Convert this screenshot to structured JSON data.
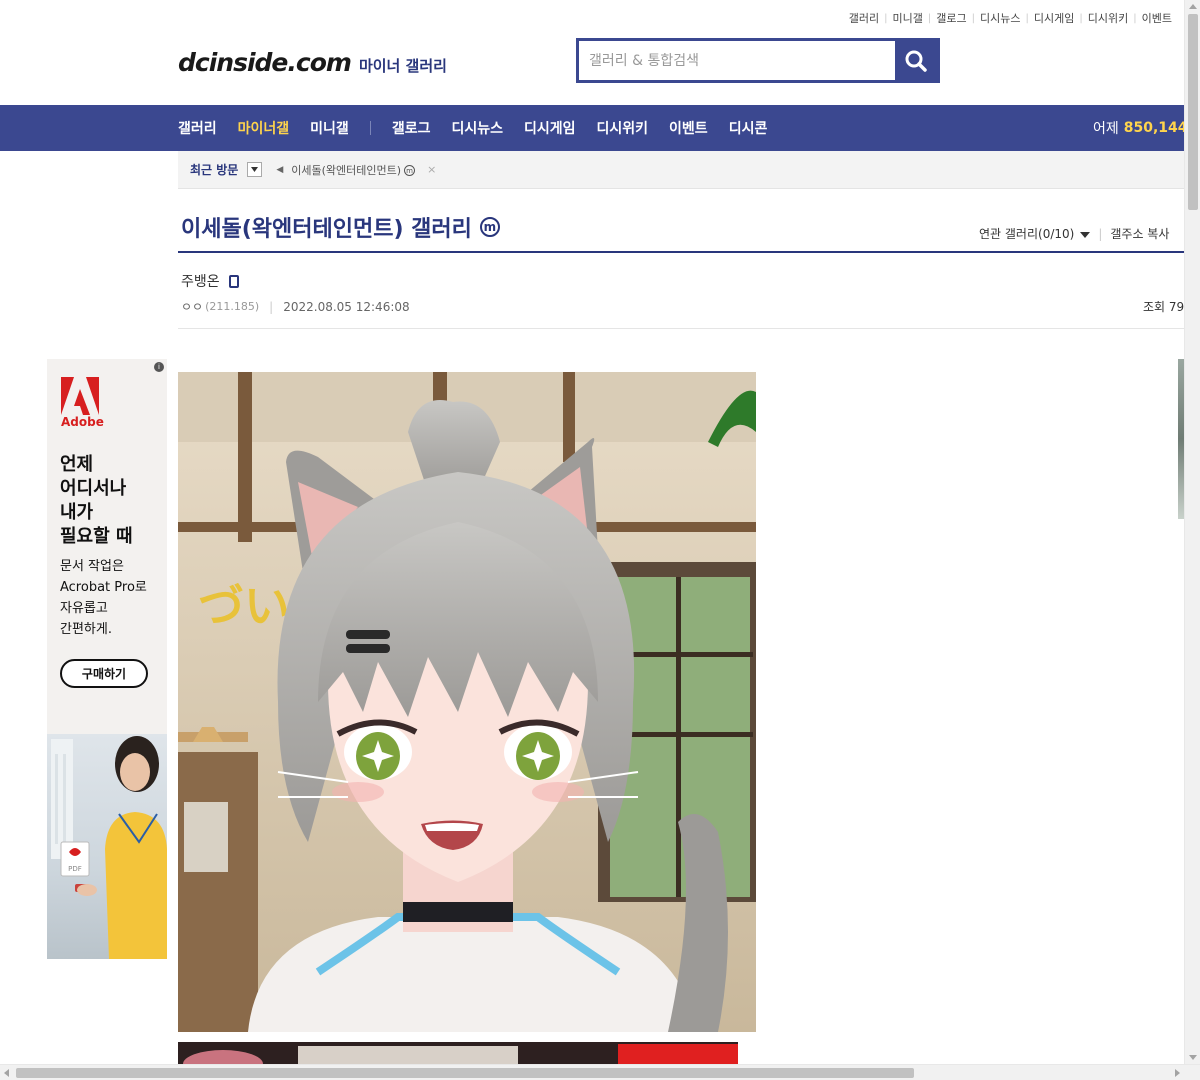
{
  "top_links": [
    "갤러리",
    "미니갤",
    "갤로그",
    "디시뉴스",
    "디시게임",
    "디시위키",
    "이벤트"
  ],
  "header": {
    "brand": "dcinside.com",
    "subtitle": "마이너 갤러리",
    "search_placeholder": "갤러리 & 통합검색"
  },
  "nav": {
    "items": [
      "갤러리",
      "마이너갤",
      "미니갤",
      "갤로그",
      "디시뉴스",
      "디시게임",
      "디시위키",
      "이벤트",
      "디시콘"
    ],
    "active_index": 1,
    "visits_label": "어제",
    "visits_value": "850,144"
  },
  "recent": {
    "label": "최근 방문",
    "item": "이세돌(왁엔터테인먼트)",
    "badge": "m",
    "close": "×"
  },
  "gallery": {
    "title": "이세돌(왁엔터테인먼트) 갤러리",
    "badge": "m",
    "related": "연관 갤러리(0/10)",
    "copy_address": "갤주소 복사"
  },
  "post": {
    "author": "주뱅온",
    "nick": "ㅇㅇ",
    "ip": "(211.185)",
    "date": "2022.08.05 12:46:08",
    "views_label": "조회 79"
  },
  "ad": {
    "brand": "Adobe",
    "headline": "언제\n어디서나\n내가\n필요할 때",
    "body": "문서 작업은\nAcrobat Pro로\n자유롭고\n간편하게.",
    "cta": "구매하기",
    "pdf_label": "PDF"
  },
  "image_text": "づい",
  "colors": {
    "primary": "#3b4890",
    "title": "#29367c",
    "accent": "#ffd44c",
    "adobe_red": "#d71f1f"
  }
}
